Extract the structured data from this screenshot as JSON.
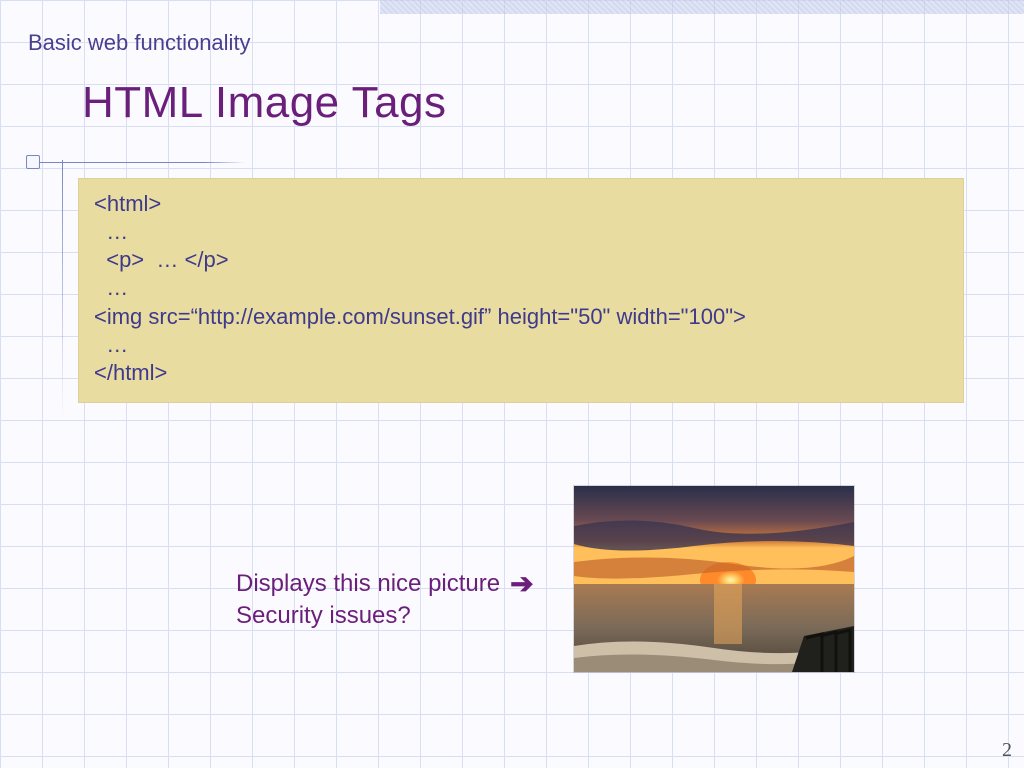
{
  "breadcrumb": "Basic web functionality",
  "title": "HTML Image Tags",
  "code": {
    "l1": "<html>",
    "l2": "  …",
    "l3": "  <p>  … </p>",
    "l4": "  …",
    "l5": "<img src=“http://example.com/sunset.gif” height=\"50\" width=\"100\">",
    "l6": "  …",
    "l7": "</html>"
  },
  "caption": {
    "line1": "Displays this nice picture",
    "line2": "Security issues?"
  },
  "pageNumber": "2"
}
